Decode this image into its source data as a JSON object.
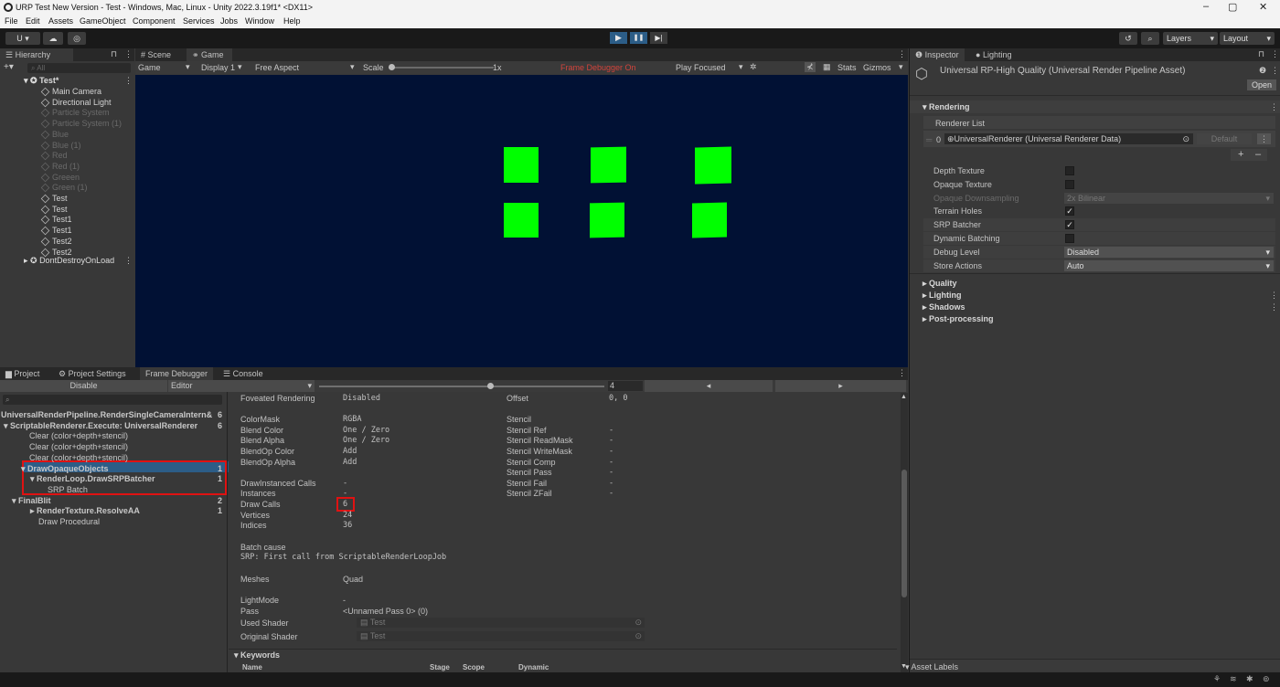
{
  "window": {
    "title": "URP Test New Version - Test - Windows, Mac, Linux - Unity 2022.3.19f1* <DX11>",
    "min": "–",
    "max": "▢",
    "close": "✕"
  },
  "menu": [
    "File",
    "Edit",
    "Assets",
    "GameObject",
    "Component",
    "Services",
    "Jobs",
    "Window",
    "Help"
  ],
  "toolbar": {
    "account": "U ▾",
    "layers": "Layers",
    "layout": "Layout",
    "play": "▶",
    "pause": "❚❚",
    "step": "▶|"
  },
  "hierarchy": {
    "tab": "Hierarchy",
    "search_placeholder": "All",
    "scene": "Test*",
    "items": [
      {
        "label": "Main Camera",
        "dim": false
      },
      {
        "label": "Directional Light",
        "dim": false
      },
      {
        "label": "Particle System",
        "dim": true
      },
      {
        "label": "Particle System (1)",
        "dim": true
      },
      {
        "label": "Blue",
        "dim": true
      },
      {
        "label": "Blue (1)",
        "dim": true
      },
      {
        "label": "Red",
        "dim": true
      },
      {
        "label": "Red (1)",
        "dim": true
      },
      {
        "label": "Greeen",
        "dim": true
      },
      {
        "label": "Green (1)",
        "dim": true
      },
      {
        "label": "Test",
        "dim": false
      },
      {
        "label": "Test",
        "dim": false
      },
      {
        "label": "Test1",
        "dim": false
      },
      {
        "label": "Test1",
        "dim": false
      },
      {
        "label": "Test2",
        "dim": false
      },
      {
        "label": "Test2",
        "dim": false
      }
    ],
    "dontdestroy": "DontDestroyOnLoad"
  },
  "game": {
    "tab_scene": "Scene",
    "tab_game": "Game",
    "display_mode": "Game",
    "display": "Display 1",
    "aspect": "Free Aspect",
    "scale_label": "Scale",
    "scale_value": "1x",
    "frame_debugger": "Frame Debugger On",
    "play_focused": "Play Focused",
    "stats": "Stats",
    "gizmos": "Gizmos",
    "bg_color": "#011134",
    "square_color": "#00ff00"
  },
  "bottom_tabs": {
    "project": "Project",
    "project_settings": "Project Settings",
    "frame_debugger": "Frame Debugger",
    "console": "Console"
  },
  "frame_debugger": {
    "disable": "Disable",
    "editor": "Editor",
    "event_index": "4",
    "tree": [
      {
        "label": "UniversalRenderPipeline.RenderSingleCameraIntern&",
        "count": "6",
        "bold": true
      },
      {
        "label": "ScriptableRenderer.Execute: UniversalRenderer",
        "count": "6",
        "bold": true
      },
      {
        "label": "Clear (color+depth+stencil)",
        "count": "",
        "bold": false
      },
      {
        "label": "Clear (color+depth+stencil)",
        "count": "",
        "bold": false
      },
      {
        "label": "Clear (color+depth+stencil)",
        "count": "",
        "bold": false
      },
      {
        "label": "DrawOpaqueObjects",
        "count": "1",
        "bold": true
      },
      {
        "label": "RenderLoop.DrawSRPBatcher",
        "count": "1",
        "bold": true
      },
      {
        "label": "SRP Batch",
        "count": "",
        "bold": false
      },
      {
        "label": "FinalBlit",
        "count": "2",
        "bold": true
      },
      {
        "label": "RenderTexture.ResolveAA",
        "count": "1",
        "bold": true
      },
      {
        "label": "Draw Procedural",
        "count": "",
        "bold": false
      }
    ],
    "details_left": [
      [
        "Foveated Rendering",
        "Disabled"
      ],
      [
        "",
        ""
      ],
      [
        "ColorMask",
        "RGBA"
      ],
      [
        "Blend Color",
        "One / Zero"
      ],
      [
        "Blend Alpha",
        "One / Zero"
      ],
      [
        "BlendOp Color",
        "Add"
      ],
      [
        "BlendOp Alpha",
        "Add"
      ],
      [
        "",
        ""
      ],
      [
        "DrawInstanced Calls",
        "-"
      ],
      [
        "Instances",
        "-"
      ],
      [
        "Draw Calls",
        "6"
      ],
      [
        "Vertices",
        "24"
      ],
      [
        "Indices",
        "36"
      ]
    ],
    "details_right": [
      [
        "Offset",
        "0, 0"
      ],
      [
        "",
        ""
      ],
      [
        "Stencil",
        ""
      ],
      [
        "Stencil Ref",
        "-"
      ],
      [
        "Stencil ReadMask",
        "-"
      ],
      [
        "Stencil WriteMask",
        "-"
      ],
      [
        "Stencil Comp",
        "-"
      ],
      [
        "Stencil Pass",
        "-"
      ],
      [
        "Stencil Fail",
        "-"
      ],
      [
        "Stencil ZFail",
        "-"
      ]
    ],
    "batch_cause_label": "Batch cause",
    "batch_cause": "SRP: First call from ScriptableRenderLoopJob",
    "meshes_label": "Meshes",
    "meshes": "Quad",
    "lightmode_label": "LightMode",
    "lightmode": "-",
    "pass_label": "Pass",
    "pass": "<Unnamed Pass 0> (0)",
    "used_shader_label": "Used Shader",
    "used_shader": "Test",
    "original_shader_label": "Original Shader",
    "original_shader": "Test",
    "keywords": "Keywords",
    "kw_cols": [
      "Name",
      "Stage",
      "Scope",
      "Dynamic"
    ]
  },
  "inspector": {
    "tab": "Inspector",
    "tab_lighting": "Lighting",
    "asset_title": "Universal RP-High Quality (Universal Render Pipeline Asset)",
    "open": "Open",
    "rendering": "Rendering",
    "renderer_list": "Renderer List",
    "renderer_index": "0",
    "renderer": "UniversalRenderer (Universal Renderer Data)",
    "default": "Default",
    "plus": "+",
    "minus": "–",
    "settings": [
      {
        "label": "Depth Texture",
        "type": "check",
        "value": false,
        "dim": false
      },
      {
        "label": "Opaque Texture",
        "type": "check",
        "value": false,
        "dim": false
      },
      {
        "label": "Opaque Downsampling",
        "type": "dropdown",
        "value": "2x Bilinear",
        "dim": true
      },
      {
        "label": "Terrain Holes",
        "type": "check",
        "value": true,
        "dim": false
      },
      {
        "label": "SRP Batcher",
        "type": "check",
        "value": true,
        "dim": false
      },
      {
        "label": "Dynamic Batching",
        "type": "check",
        "value": false,
        "dim": false
      },
      {
        "label": "Debug Level",
        "type": "dropdown",
        "value": "Disabled",
        "dim": false
      },
      {
        "label": "Store Actions",
        "type": "dropdown",
        "value": "Auto",
        "dim": false
      }
    ],
    "sections": [
      "Quality",
      "Lighting",
      "Shadows",
      "Post-processing"
    ],
    "asset_labels": "Asset Labels"
  }
}
